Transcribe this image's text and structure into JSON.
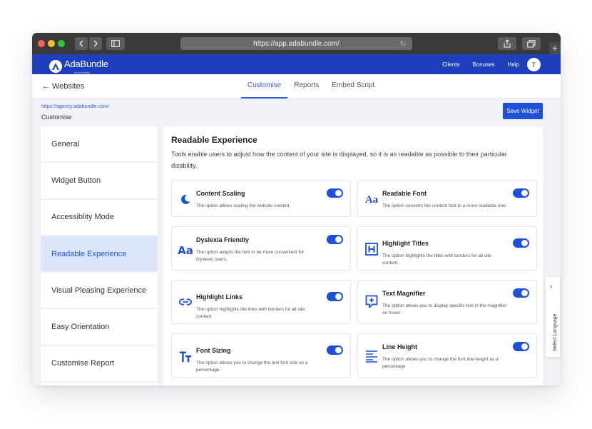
{
  "browser": {
    "url": "https://app.adabundle.com/",
    "new_tab_glyph": "+"
  },
  "app": {
    "logo_text": "AdaBundle",
    "logo_sub": "Accessibility",
    "nav": [
      "Clients",
      "Bonuses",
      "Help"
    ],
    "avatar_initial": "T",
    "brand_color": "#1d3fbb"
  },
  "header": {
    "back_label": "← Websites",
    "tabs": [
      {
        "label": "Customise",
        "active": true
      },
      {
        "label": "Reports",
        "active": false
      },
      {
        "label": "Embed Script",
        "active": false
      }
    ]
  },
  "site": {
    "url": "https://agency.adabundle.com/",
    "subtitle": "Customise",
    "save_label": "Save Widget"
  },
  "sidebar": {
    "items": [
      {
        "label": "General",
        "active": false
      },
      {
        "label": "Widget Button",
        "active": false
      },
      {
        "label": "Accessiblity Mode",
        "active": false
      },
      {
        "label": "Readable Experience",
        "active": true
      },
      {
        "label": "Visual Pleasing Experience",
        "active": false
      },
      {
        "label": "Easy Orientation",
        "active": false
      },
      {
        "label": "Customise Report",
        "active": false
      }
    ]
  },
  "panel": {
    "title": "Readable Experience",
    "description": "Tools enable users to adjust how the content of your site is displayed, so it is as readable as possible to their particular disability.",
    "features": [
      {
        "icon": "moon-icon",
        "title": "Content Scaling",
        "desc": "The option allows scaling the website content.",
        "enabled": true
      },
      {
        "icon": "readable-font-icon",
        "title": "Readable Font",
        "desc": "The option converts the content font to a more readable one.",
        "enabled": true
      },
      {
        "icon": "dyslexia-aa-icon",
        "title": "Dyslexia Friendly",
        "desc": "The option adapts the font to be more convenient for Dyslexic users.",
        "enabled": true
      },
      {
        "icon": "heading-box-icon",
        "title": "Highlight Titles",
        "desc": "The option highlights the titles with borders for all site content.",
        "enabled": true
      },
      {
        "icon": "link-icon",
        "title": "Highlight Links",
        "desc": "The option highlights the links with borders for all site content.",
        "enabled": true
      },
      {
        "icon": "magnifier-icon",
        "title": "Text Magnifier",
        "desc": "The option allows you to display specific text in the magnifier on hover.",
        "enabled": true
      },
      {
        "icon": "font-size-icon",
        "title": "Font Sizing",
        "desc": "The option allows you to change the text font size as a percentage.",
        "enabled": true
      },
      {
        "icon": "line-height-icon",
        "title": "Line Height",
        "desc": "The option allows you to change the font line-height as a percentage",
        "enabled": true
      }
    ],
    "glyphs": {
      "aa": "Aa",
      "h": "H",
      "tt": "TT"
    }
  },
  "language": {
    "label": "Select Language",
    "chevron": "›"
  }
}
